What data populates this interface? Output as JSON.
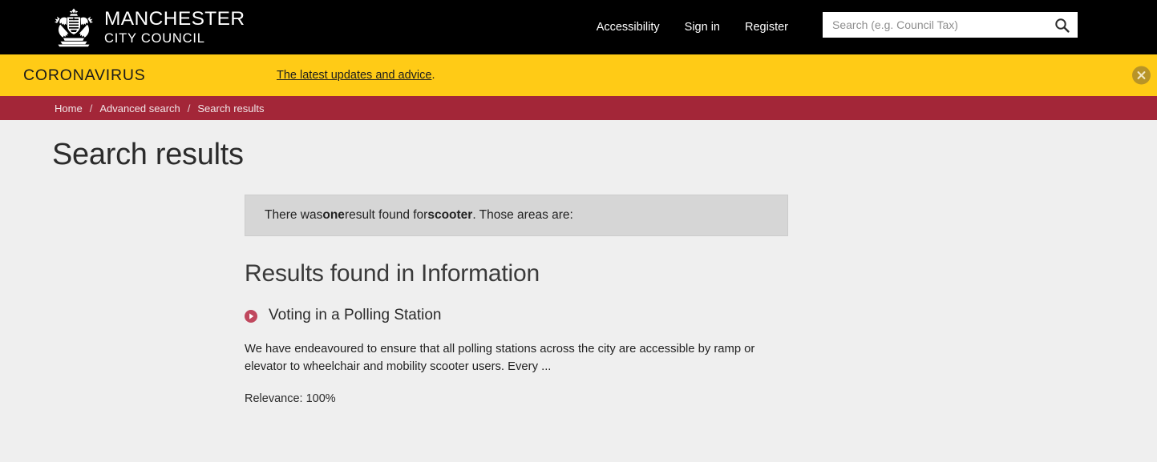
{
  "header": {
    "logo": {
      "crest_icon": "manchester-coat-of-arms-icon",
      "line1": "MANCHESTER",
      "line2": "CITY COUNCIL"
    },
    "nav": [
      {
        "label": "Accessibility"
      },
      {
        "label": "Sign in"
      },
      {
        "label": "Register"
      }
    ],
    "search": {
      "placeholder": "Search (e.g. Council Tax)",
      "value": "",
      "button_icon": "search-icon"
    },
    "background_color": "#000000"
  },
  "covid_banner": {
    "title": "CORONAVIRUS",
    "link_text": "The latest updates and advice",
    "trailing_punctuation": ".",
    "close_icon": "close-icon",
    "background_color": "#ffcb16",
    "close_button_color": "#b89427"
  },
  "breadcrumb": {
    "separator": "/",
    "items": [
      {
        "label": "Home"
      },
      {
        "label": "Advanced search"
      },
      {
        "label": "Search results"
      }
    ],
    "background_color": "#a32638"
  },
  "main": {
    "page_title": "Search results",
    "summary": {
      "prefix": "There was ",
      "count_word": "one",
      "middle": " result found for ",
      "query": "scooter",
      "suffix": ". Those areas are:"
    },
    "results_heading": "Results found in Information",
    "results": [
      {
        "bullet_icon": "play-circle-icon",
        "title": "Voting in a Polling Station",
        "description": "We have endeavoured to ensure that all polling stations across the city are accessible by ramp or elevator to wheelchair and mobility scooter users. Every ...",
        "relevance": "Relevance: 100%"
      }
    ],
    "background_color": "#efefef",
    "summary_box_color": "#d6d6d6",
    "accent_color": "#c0485e"
  }
}
